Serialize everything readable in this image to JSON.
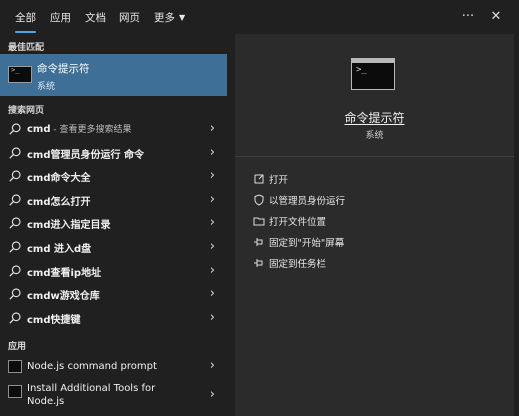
{
  "tabs": [
    {
      "label": "全部",
      "active": true
    },
    {
      "label": "应用",
      "active": false
    },
    {
      "label": "文档",
      "active": false
    },
    {
      "label": "网页",
      "active": false
    },
    {
      "label": "更多",
      "active": false
    }
  ],
  "header": {
    "more_options": "···",
    "close": "✕"
  },
  "left": {
    "best_match_title": "最佳匹配",
    "best_match": {
      "title": "命令提示符",
      "subtitle": "系统"
    },
    "web_search_title": "搜索网页",
    "web_results": [
      {
        "text": "cmd",
        "hint": " - 查看更多搜索结果"
      },
      {
        "text": "cmd管理员身份运行 命令",
        "hint": ""
      },
      {
        "text": "cmd命令大全",
        "hint": ""
      },
      {
        "text": "cmd怎么打开",
        "hint": ""
      },
      {
        "text": "cmd进入指定目录",
        "hint": ""
      },
      {
        "text": "cmd 进入d盘",
        "hint": ""
      },
      {
        "text": "cmd查看ip地址",
        "hint": ""
      },
      {
        "text": "cmdw游戏仓库",
        "hint": ""
      },
      {
        "text": "cmd快捷键",
        "hint": ""
      }
    ],
    "apps_title": "应用",
    "apps": [
      {
        "text": "Node.js command prompt"
      },
      {
        "text": "Install Additional Tools for Node.js"
      }
    ]
  },
  "right": {
    "title": "命令提示符",
    "subtitle": "系统",
    "actions": [
      {
        "label": "打开",
        "icon": "open-icon"
      },
      {
        "label": "以管理员身份运行",
        "icon": "shield-icon"
      },
      {
        "label": "打开文件位置",
        "icon": "folder-icon"
      },
      {
        "label": "固定到\"开始\"屏幕",
        "icon": "pin-icon"
      },
      {
        "label": "固定到任务栏",
        "icon": "pin-icon"
      }
    ]
  },
  "colors": {
    "accent": "#4ca5e8",
    "selected": "#3e6f96",
    "panel": "#2b2b2b",
    "background": "#202020"
  }
}
